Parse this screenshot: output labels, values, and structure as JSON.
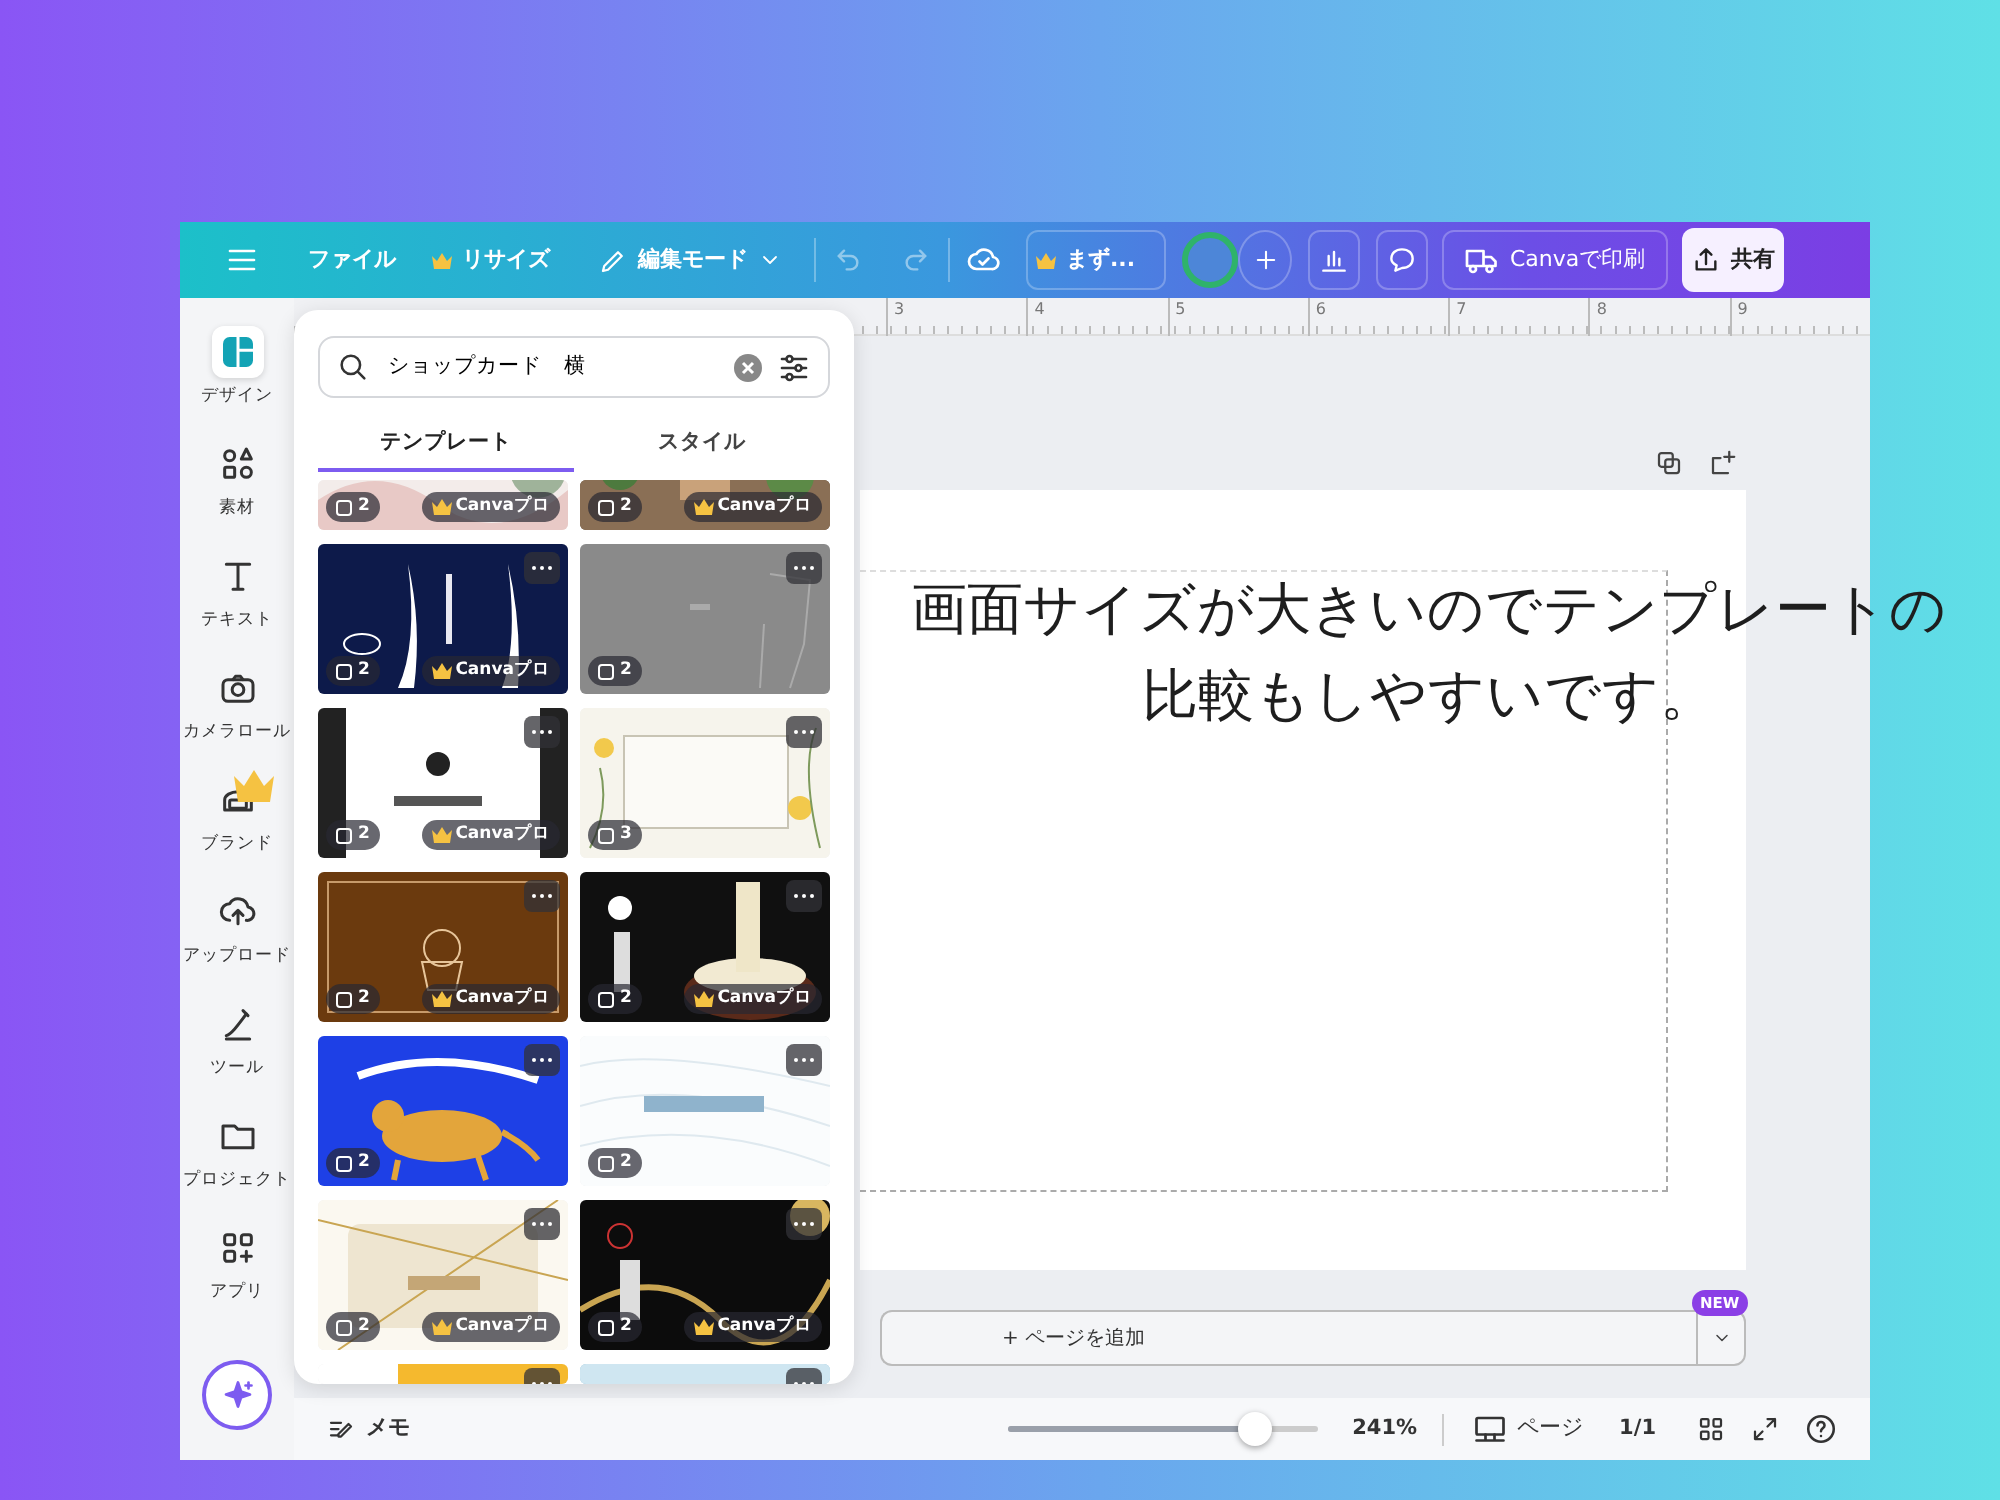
{
  "top_bar": [
    {
      "kind": "menu",
      "disabled": false
    },
    {
      "kind": "text",
      "label": "ファイル",
      "disabled": false
    },
    {
      "kind": "crown",
      "label": "リサイズ",
      "disabled": false
    },
    {
      "kind": "edit",
      "label": "編集モード",
      "disabled": false
    },
    {
      "kind": "undo",
      "disabled": true
    },
    {
      "kind": "redo",
      "disabled": true
    },
    {
      "kind": "save",
      "disabled": false
    },
    {
      "kind": "crown-box",
      "label": "まず...",
      "disabled": false
    },
    {
      "kind": "avatar",
      "disabled": false
    },
    {
      "kind": "add",
      "disabled": false
    },
    {
      "kind": "chart",
      "disabled": false
    },
    {
      "kind": "comment",
      "disabled": false
    },
    {
      "kind": "print",
      "label": "Canvaで印刷",
      "disabled": false
    },
    {
      "kind": "share",
      "label": "共有",
      "disabled": false
    }
  ],
  "sidebar": {
    "items": [
      {
        "kind": "design",
        "label": "デザイン",
        "selected": true,
        "pro": false
      },
      {
        "kind": "elements",
        "label": "素材",
        "selected": false,
        "pro": false
      },
      {
        "kind": "text",
        "label": "テキスト",
        "selected": false,
        "pro": false
      },
      {
        "kind": "camera",
        "label": "カメラロール",
        "selected": false,
        "pro": false
      },
      {
        "kind": "brand",
        "label": "ブランド",
        "selected": false,
        "pro": true
      },
      {
        "kind": "upload",
        "label": "アップロード",
        "selected": false,
        "pro": false
      },
      {
        "kind": "tools",
        "label": "ツール",
        "selected": false,
        "pro": false
      },
      {
        "kind": "projects",
        "label": "プロジェクト",
        "selected": false,
        "pro": false
      },
      {
        "kind": "apps",
        "label": "アプリ",
        "selected": false,
        "pro": false
      }
    ]
  },
  "ruler": [
    "3",
    "4",
    "5",
    "6",
    "7",
    "8",
    "9"
  ],
  "panel": {
    "search": {
      "value": "ショップカード　横"
    },
    "tabs": [
      {
        "label": "テンプレート",
        "selected": true
      },
      {
        "label": "スタイル",
        "selected": false
      }
    ],
    "templates": [
      {
        "pages": "2",
        "pro": "Canvaプロ",
        "more": false
      },
      {
        "pages": "2",
        "pro": "Canvaプロ",
        "more": false
      },
      {
        "pages": "2",
        "pro": "Canvaプロ",
        "more": true
      },
      {
        "pages": "2",
        "more": true
      },
      {
        "pages": "2",
        "pro": "Canvaプロ",
        "more": true
      },
      {
        "pages": "3",
        "more": true
      },
      {
        "pages": "2",
        "pro": "Canvaプロ",
        "more": true
      },
      {
        "pages": "2",
        "pro": "Canvaプロ",
        "more": true
      },
      {
        "pages": "2",
        "more": true
      },
      {
        "pages": "2",
        "more": true
      },
      {
        "pages": "2",
        "pro": "Canvaプロ",
        "more": true
      },
      {
        "pages": "2",
        "pro": "Canvaプロ",
        "more": true
      },
      {
        "more": true
      },
      {
        "more": true
      }
    ]
  },
  "canvas": {
    "caption": [
      "画面サイズが大きいのでテンプレートの",
      "比較もしやすいです。"
    ],
    "add_page": "+ ページを追加",
    "badge": "NEW"
  },
  "bottom_bar": {
    "notes": "メモ",
    "zoom": {
      "level": 0.79,
      "reading": "241%"
    },
    "pages": "ページ",
    "page_count": "1/1"
  }
}
